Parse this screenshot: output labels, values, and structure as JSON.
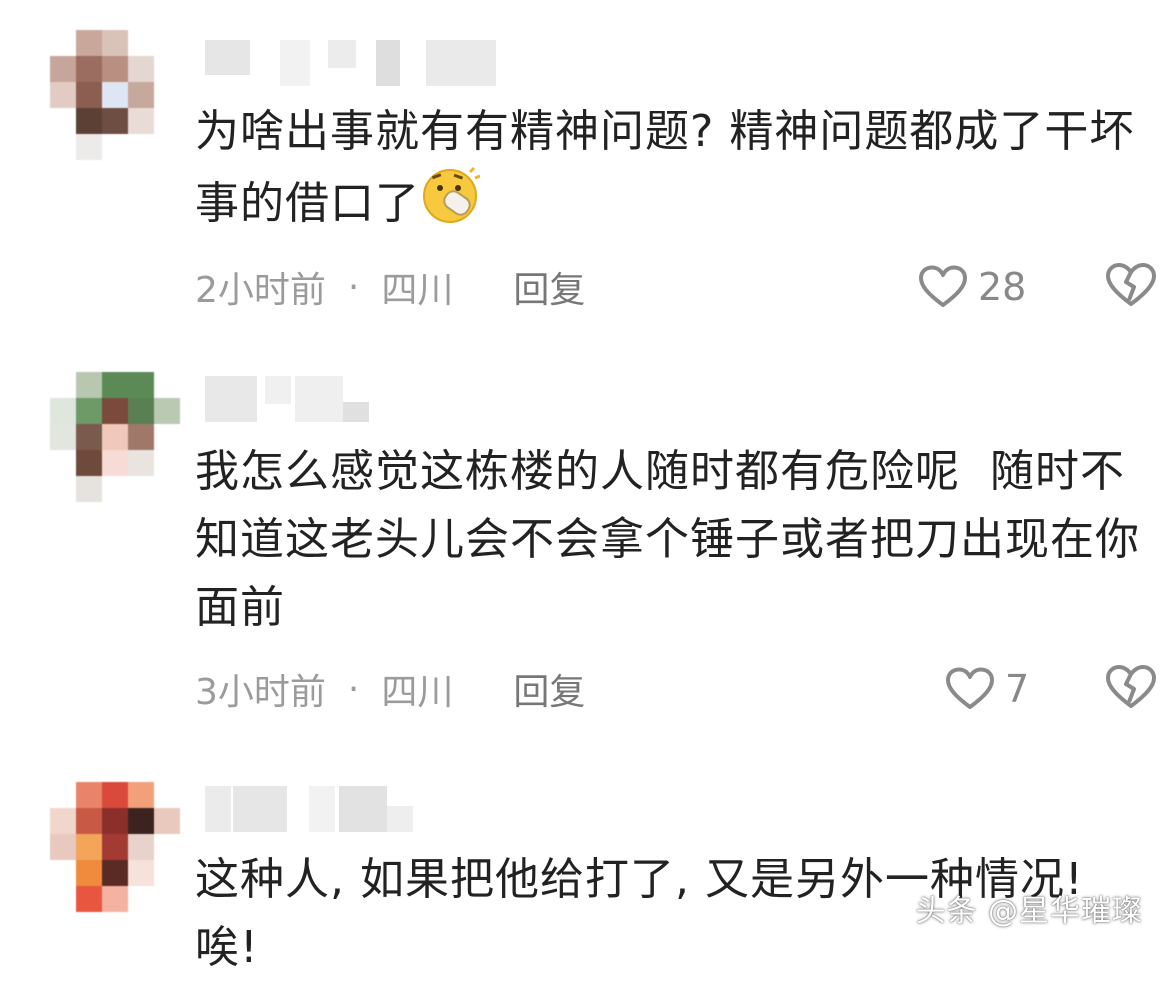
{
  "comments": [
    {
      "text": "为啥出事就有有精神问题? 精神问题都成了干坏事的借口了",
      "emoji": "face-with-hand-over-mouth-emoji",
      "time": "2小时前",
      "location": "四川",
      "reply_label": "回复",
      "likes": "28"
    },
    {
      "text": "我怎么感觉这栋楼的人随时都有危险呢  随时不知道这老头儿会不会拿个锤子或者把刀出现在你面前",
      "time": "3小时前",
      "location": "四川",
      "reply_label": "回复",
      "likes": "7"
    },
    {
      "text": "这种人, 如果把他给打了, 又是另外一种情况! 唉!"
    }
  ],
  "meta_separator": "·",
  "icons": {
    "like": "heart-outline-icon",
    "dislike": "broken-heart-icon"
  },
  "colors": {
    "text": "#222222",
    "meta": "#9b9b9b",
    "icon": "#8a8a8a"
  },
  "watermark": "头条 @星华璀璨"
}
